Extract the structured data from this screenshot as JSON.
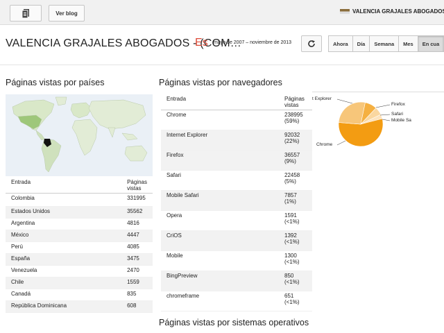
{
  "topbar": {
    "posts_icon": "posts-list-icon",
    "view_blog": "Ver blog",
    "blog_name": "VALENCIA GRAJALES ABOGADOS (LI"
  },
  "header": {
    "title": "VALENCIA GRAJALES ABOGADOS - (COM…",
    "title_suffix": "Es",
    "date_range": "mayo de 2007 – noviembre de 2013",
    "refresh_icon": "refresh-icon",
    "periods": [
      "Ahora",
      "Día",
      "Semana",
      "Mes",
      "En cua"
    ],
    "active_period": "En cua"
  },
  "countries": {
    "title": "Páginas vistas por países",
    "col_entry": "Entrada",
    "col_views": "Páginas vistas",
    "rows": [
      {
        "name": "Colombia",
        "views": "331995"
      },
      {
        "name": "Estados Unidos",
        "views": "35562"
      },
      {
        "name": "Argentina",
        "views": "4816"
      },
      {
        "name": "México",
        "views": "4447"
      },
      {
        "name": "Perú",
        "views": "4085"
      },
      {
        "name": "España",
        "views": "3475"
      },
      {
        "name": "Venezuela",
        "views": "2470"
      },
      {
        "name": "Chile",
        "views": "1559"
      },
      {
        "name": "Canadá",
        "views": "835"
      },
      {
        "name": "República Dominicana",
        "views": "608"
      }
    ]
  },
  "browsers": {
    "title": "Páginas vistas por navegadores",
    "col_entry": "Entrada",
    "col_views": "Páginas vistas",
    "rows": [
      {
        "name": "Chrome",
        "views": "238995",
        "pct": "(59%)"
      },
      {
        "name": "Internet Explorer",
        "views": "92032",
        "pct": "(22%)"
      },
      {
        "name": "Firefox",
        "views": "36557",
        "pct": "(9%)"
      },
      {
        "name": "Safari",
        "views": "22458",
        "pct": "(5%)"
      },
      {
        "name": "Mobile Safari",
        "views": "7857",
        "pct": "(1%)"
      },
      {
        "name": "Opera",
        "views": "1591",
        "pct": "(<1%)"
      },
      {
        "name": "CriOS",
        "views": "1392",
        "pct": "(<1%)"
      },
      {
        "name": "Mobile",
        "views": "1300",
        "pct": "(<1%)"
      },
      {
        "name": "BingPreview",
        "views": "850",
        "pct": "(<1%)"
      },
      {
        "name": "chromeframe",
        "views": "651",
        "pct": "(<1%)"
      }
    ]
  },
  "os": {
    "title": "Páginas vistas por sistemas operativos"
  },
  "pie": {
    "labels": {
      "ie": "t Explorer",
      "firefox": "Firefox",
      "safari": "Safari",
      "mobile_safari": "Mobile Sa",
      "chrome": "Chrome"
    },
    "colors": {
      "chrome": "#f39c12",
      "ie": "#f5b041",
      "firefox": "#f8c471",
      "safari": "#fad7a0",
      "mobile_safari": "#fde3bd"
    }
  }
}
